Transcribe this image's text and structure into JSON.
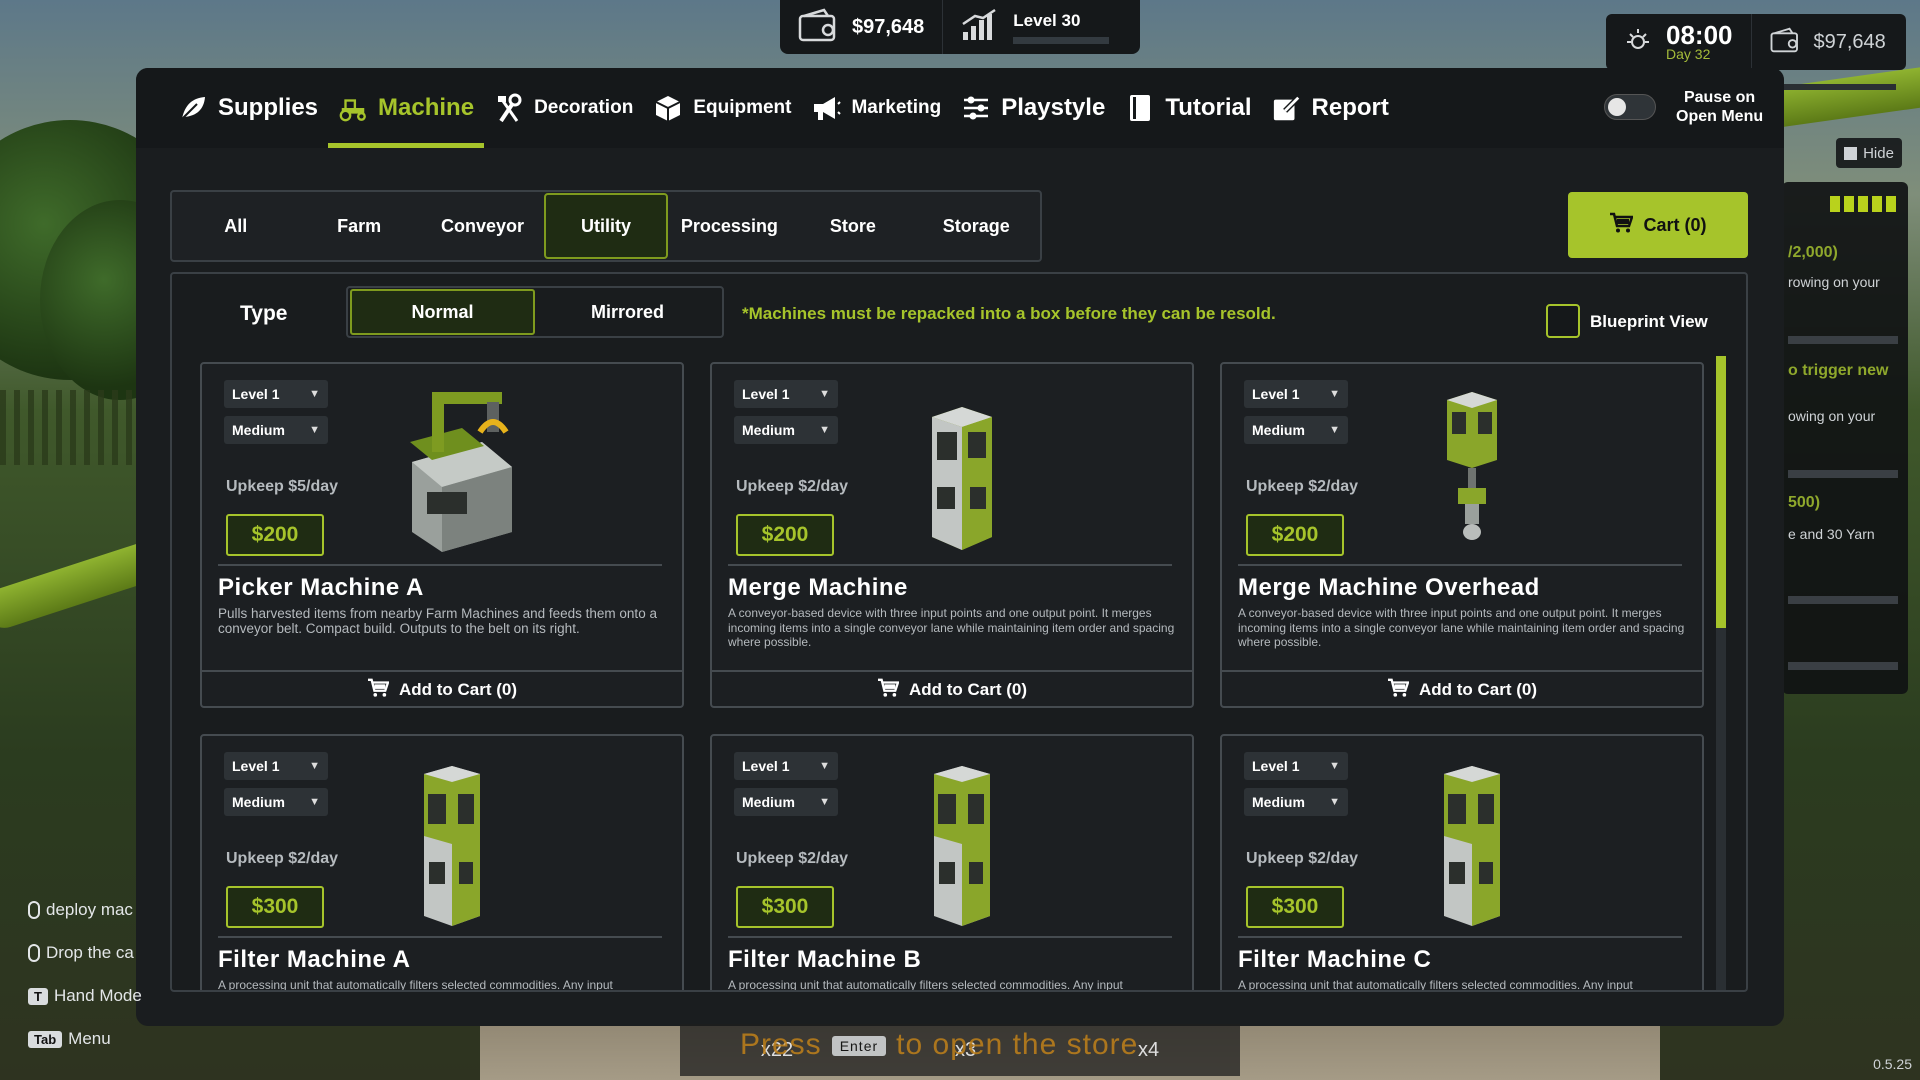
{
  "hud": {
    "money": "$97,648",
    "level": "Level 30",
    "level_progress": 0.0,
    "clock_time": "08:00",
    "day": "Day 32",
    "money_right": "$97,648"
  },
  "side_panel": {
    "hide_label": "Hide",
    "lines": [
      "/2,000)",
      "rowing on your",
      "o trigger new",
      "owing on your",
      "500)",
      "e and 30 Yarn"
    ]
  },
  "nav": {
    "items": [
      {
        "label": "Supplies",
        "icon": "leaf-icon"
      },
      {
        "label": "Machine",
        "icon": "tractor-icon"
      },
      {
        "label": "Decoration",
        "icon": "tools-icon"
      },
      {
        "label": "Equipment",
        "icon": "box-icon"
      },
      {
        "label": "Marketing",
        "icon": "megaphone-icon"
      },
      {
        "label": "Playstyle",
        "icon": "sliders-icon"
      },
      {
        "label": "Tutorial",
        "icon": "book-icon"
      },
      {
        "label": "Report",
        "icon": "pencil-note-icon"
      }
    ],
    "active": "Machine",
    "pause_label_1": "Pause on",
    "pause_label_2": "Open Menu"
  },
  "categories": [
    "All",
    "Farm",
    "Conveyor",
    "Utility",
    "Processing",
    "Store",
    "Storage"
  ],
  "active_category": "Utility",
  "cart_label": "Cart (0)",
  "type": {
    "label": "Type",
    "options": [
      "Normal",
      "Mirrored"
    ],
    "active": "Normal"
  },
  "notice": "*Machines must be repacked into a box before they can be resold.",
  "blueprint_label": "Blueprint View",
  "cards": [
    {
      "level": "Level 1",
      "size": "Medium",
      "upkeep": "Upkeep $5/day",
      "price": "$200",
      "title": "Picker Machine A",
      "desc": "Pulls harvested items from nearby Farm Machines and feeds them onto a conveyor belt. Compact build. Outputs to the belt on its right.",
      "cart": "Add to Cart (0)"
    },
    {
      "level": "Level 1",
      "size": "Medium",
      "upkeep": "Upkeep $2/day",
      "price": "$200",
      "title": "Merge Machine",
      "desc": "A conveyor-based device with three input points and one output point. It merges incoming items into a single conveyor lane while maintaining item order and spacing where possible.",
      "cart": "Add to Cart (0)"
    },
    {
      "level": "Level 1",
      "size": "Medium",
      "upkeep": "Upkeep $2/day",
      "price": "$200",
      "title": "Merge Machine Overhead",
      "desc": "A conveyor-based device with three input points and one output point. It merges incoming items into a single conveyor lane while maintaining item order and spacing where possible.",
      "cart": "Add to Cart (0)"
    },
    {
      "level": "Level 1",
      "size": "Medium",
      "upkeep": "Upkeep $2/day",
      "price": "$300",
      "title": "Filter Machine A",
      "desc": "A processing unit that automatically filters selected commodities. Any input",
      "cart": ""
    },
    {
      "level": "Level 1",
      "size": "Medium",
      "upkeep": "Upkeep $2/day",
      "price": "$300",
      "title": "Filter Machine B",
      "desc": "A processing unit that automatically filters selected commodities. Any input",
      "cart": ""
    },
    {
      "level": "Level 1",
      "size": "Medium",
      "upkeep": "Upkeep $2/day",
      "price": "$300",
      "title": "Filter Machine C",
      "desc": "A processing unit that automatically filters selected commodities. Any input",
      "cart": ""
    }
  ],
  "hints": [
    {
      "text": "deploy mac"
    },
    {
      "text": "Drop the ca"
    },
    {
      "key": "T",
      "text": "Hand Mode"
    },
    {
      "key": "Tab",
      "text": "Menu"
    }
  ],
  "hotbar": {
    "items": [
      "x22",
      "x3",
      "x4"
    ],
    "press_text_1": "Press",
    "enter_key": "Enter",
    "press_text_2": "to open the store"
  },
  "version": "0.5.25",
  "colors": {
    "accent": "#a6c42b",
    "panel": "#1a1d1f",
    "nav": "#15181a"
  }
}
